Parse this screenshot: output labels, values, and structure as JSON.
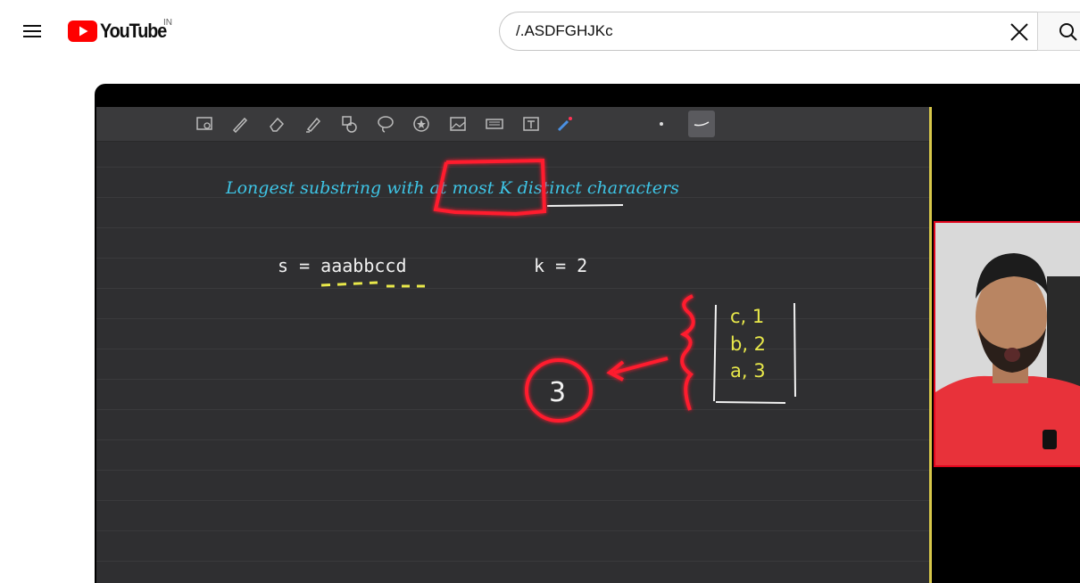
{
  "header": {
    "menu_icon": "hamburger-menu-icon",
    "logo_text": "YouTube",
    "country_code": "IN",
    "brand_color": "#FF0000"
  },
  "search": {
    "query": "/.ASDFGHJKc",
    "clear_icon": "close-icon",
    "search_icon": "search-icon"
  },
  "video": {
    "board_title": "Longest substring with at most K distinct characters",
    "equation_s": "s = aaabbccd",
    "equation_k": "k = 2",
    "circled_value": "3",
    "map_entries": [
      "c, 1",
      "b, 2",
      "a, 3"
    ],
    "toolbar_icons": [
      "screenshot-icon",
      "pen-icon",
      "eraser-icon",
      "highlighter-icon",
      "shapes-icon",
      "lasso-icon",
      "sticker-icon",
      "image-icon",
      "keyboard-icon",
      "text-icon",
      "laser-pointer-icon",
      "dot-size-icon",
      "stroke-style-icon"
    ],
    "colors": {
      "ink_cyan": "#3ec5e6",
      "ink_white": "#f2f2f2",
      "ink_yellow": "#e8e84a",
      "ink_red": "#ff1a2e"
    }
  }
}
